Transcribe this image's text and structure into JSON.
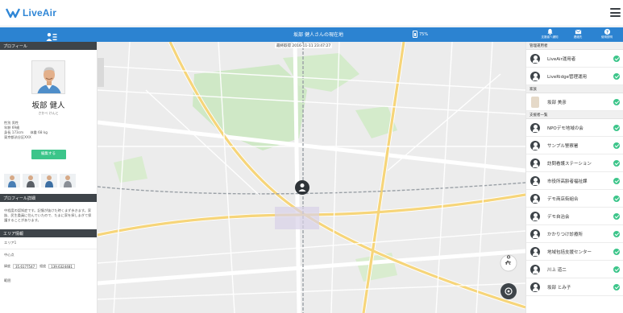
{
  "app": {
    "name": "LiveAir"
  },
  "header": {
    "title": "坂部 健人さんの現在地",
    "battery": "75%",
    "buttons": [
      {
        "label": "支援者へ通知",
        "icon": "bell-icon"
      },
      {
        "label": "連絡先",
        "icon": "mail-icon"
      },
      {
        "label": "使用説明",
        "icon": "help-icon"
      }
    ]
  },
  "map": {
    "timestamp": "最終取得 2016-11-11 23:47:27"
  },
  "profile": {
    "section_title": "プロフィール",
    "name": "坂部 健人",
    "kana": "さかべ けんと",
    "info": [
      "性別 男性",
      "年齢 69歳",
      "身長 173cm　　体重 68 kg",
      "東京都渋谷区XXX"
    ],
    "edit_label": "編集する"
  },
  "detail": {
    "section_title": "プロフィール詳細",
    "text": "中程度の認知症です。記憶が抜けた時くまず歩きます。家族、民生委員に住んでいたので、たまに家を探しまぎて保護することがあります。"
  },
  "area": {
    "section_title": "エリア情報",
    "area_name": "エリア1",
    "center_label": "中心点",
    "lat_label": "緯度",
    "lat_value": "35.6177547",
    "lng_label": "経度",
    "lng_value": "139.6324481",
    "radius_label": "範囲"
  },
  "right": {
    "groups": [
      {
        "title": "管理運用者",
        "items": [
          "LiveAir運用者",
          "LiveRidge管理運用"
        ]
      },
      {
        "title": "家族",
        "items": [
          "坂部 美彦"
        ]
      },
      {
        "title": "支援者一覧",
        "items": [
          "NPOデモ地域の会",
          "サンプル警察署",
          "訪問看護ステーション",
          "市役所高齢者福祉課",
          "デモ商店街組合",
          "デモ自治会",
          "かかりつけ診療所",
          "地域包括支援センター",
          "川上 道二",
          "坂部 とみ子"
        ]
      }
    ]
  },
  "colors": {
    "brand": "#2c83d1",
    "accent": "#3cc58a",
    "dark": "#3e4449"
  }
}
